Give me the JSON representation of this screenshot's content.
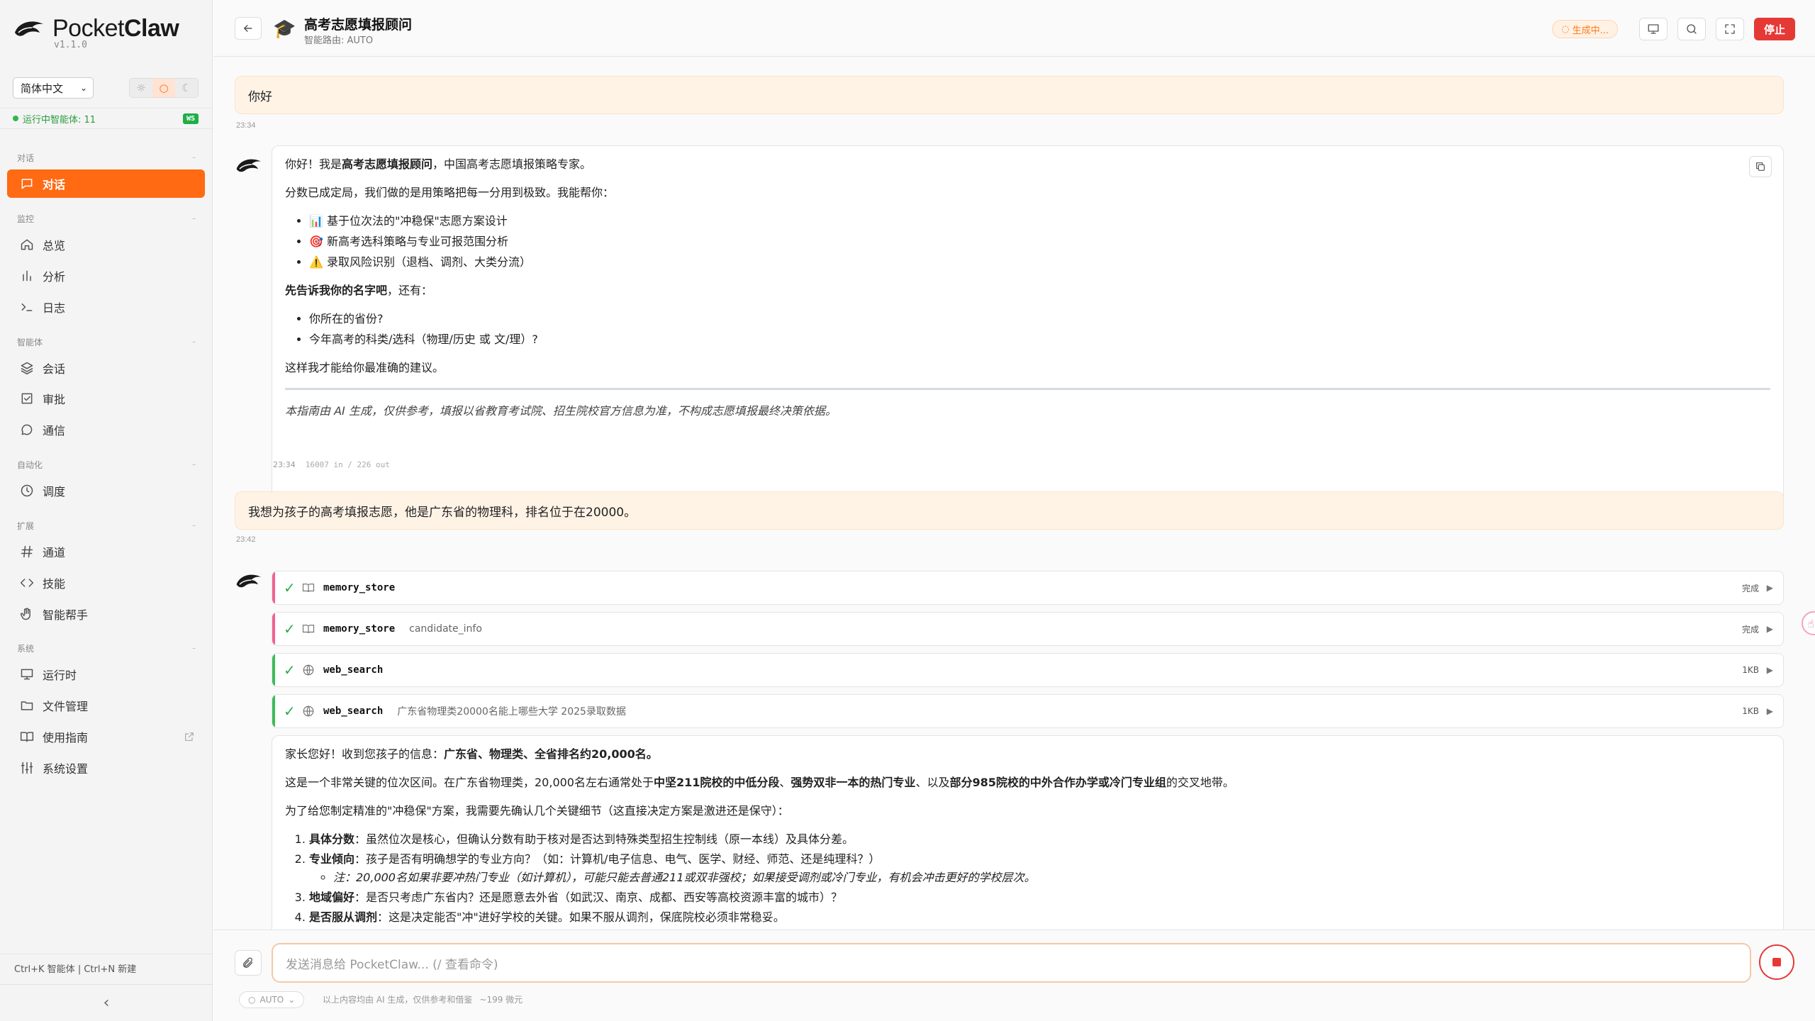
{
  "brand": {
    "name_plain": "Pocket",
    "name_bold": "Claw",
    "version": "v1.1.0"
  },
  "sidebar": {
    "language": "简体中文",
    "theme_icons": [
      "sun-icon",
      "circle-icon",
      "moon-icon"
    ],
    "status_text": "运行中智能体: 11",
    "ws_badge": "WS",
    "groups": [
      {
        "title": "对话",
        "items": [
          {
            "label": "对话",
            "icon": "chat-icon",
            "active": true
          }
        ]
      },
      {
        "title": "监控",
        "items": [
          {
            "label": "总览",
            "icon": "home-icon"
          },
          {
            "label": "分析",
            "icon": "bar-chart-icon"
          },
          {
            "label": "日志",
            "icon": "terminal-icon"
          }
        ]
      },
      {
        "title": "智能体",
        "items": [
          {
            "label": "会话",
            "icon": "layers-icon"
          },
          {
            "label": "审批",
            "icon": "checkbox-icon"
          },
          {
            "label": "通信",
            "icon": "message-icon"
          }
        ]
      },
      {
        "title": "自动化",
        "items": [
          {
            "label": "调度",
            "icon": "clock-icon"
          }
        ]
      },
      {
        "title": "扩展",
        "items": [
          {
            "label": "通道",
            "icon": "hash-icon"
          },
          {
            "label": "技能",
            "icon": "code-icon"
          },
          {
            "label": "智能帮手",
            "icon": "hand-icon"
          }
        ]
      },
      {
        "title": "系统",
        "items": [
          {
            "label": "运行时",
            "icon": "monitor-icon"
          },
          {
            "label": "文件管理",
            "icon": "folder-icon"
          },
          {
            "label": "使用指南",
            "icon": "book-icon"
          },
          {
            "label": "系统设置",
            "icon": "sliders-icon"
          }
        ]
      }
    ],
    "shortcuts": "Ctrl+K 智能体 | Ctrl+N 新建",
    "collapse_label": "‹"
  },
  "header": {
    "title": "高考志愿填报顾问",
    "subtitle": "智能路由: AUTO",
    "generating_badge": "生成中...",
    "stop_label": "停止"
  },
  "messages": {
    "user1": {
      "text": "你好",
      "time": "23:34"
    },
    "bot1": {
      "intro_prefix": "你好！我是",
      "intro_bold": "高考志愿填报顾问",
      "intro_suffix": "，中国高考志愿填报策略专家。",
      "line2": "分数已成定局，我们做的是用策略把每一分用到极致。我能帮你：",
      "capabilities": [
        {
          "emoji": "📊",
          "text": "基于位次法的\"冲稳保\"志愿方案设计"
        },
        {
          "emoji": "🎯",
          "text": "新高考选科策略与专业可报范围分析"
        },
        {
          "emoji": "⚠️",
          "text": "录取风险识别（退档、调剂、大类分流）"
        }
      ],
      "ask_bold": "先告诉我你的名字吧",
      "ask_suffix": "，还有：",
      "questions": [
        "你所在的省份?",
        "今年高考的科类/选科（物理/历史 或 文/理）?"
      ],
      "closing": "这样我才能给你最准确的建议。",
      "disclaimer": "本指南由 AI 生成，仅供参考，填报以省教育考试院、招生院校官方信息为准，不构成志愿填报最终决策依据。",
      "time": "23:34",
      "tokens": "16007 in / 226 out"
    },
    "user2": {
      "text": "我想为孩子的高考填报志愿，他是广东省的物理科，排名位于在20000。",
      "time": "23:42"
    },
    "tools": [
      {
        "name": "memory_store",
        "arg": "",
        "status": "完成",
        "icon": "book-icon",
        "color": "pink"
      },
      {
        "name": "memory_store",
        "arg": "candidate_info",
        "status": "完成",
        "icon": "book-icon",
        "color": "pink"
      },
      {
        "name": "web_search",
        "arg": "",
        "status": "1KB",
        "icon": "globe-icon",
        "color": "green"
      },
      {
        "name": "web_search",
        "arg": "广东省物理类20000名能上哪些大学 2025录取数据",
        "status": "1KB",
        "icon": "globe-icon",
        "color": "green"
      }
    ],
    "bot2": {
      "p1_prefix": "家长您好！收到您孩子的信息：",
      "p1_bold": "广东省、物理类、全省排名约20,000名。",
      "p2_a": "这是一个非常关键的位次区间。在广东省物理类，20,000名左右通常处于",
      "p2_b1": "中坚211院校的中低分段",
      "p2_c": "、",
      "p2_b2": "强势双非一本的热门专业",
      "p2_d": "、以及",
      "p2_b3": "部分985院校的中外合作办学或冷门专业组",
      "p2_e": "的交叉地带。",
      "p3": "为了给您制定精准的\"冲稳保\"方案，我需要先确认几个关键细节（这直接决定方案是激进还是保守）：",
      "items": [
        {
          "bold": "具体分数",
          "text": "：虽然位次是核心，但确认分数有助于核对是否达到特殊类型招生控制线（原一本线）及具体分差。"
        },
        {
          "bold": "专业倾向",
          "text": "：孩子是否有明确想学的专业方向？（如：计算机/电子信息、电气、医学、财经、师范、还是纯理科？）"
        },
        {
          "bold": "地域偏好",
          "text": "：是否只考虑广东省内？还是愿意去外省（如武汉、南京、成都、西安等高校资源丰富的城市）？"
        },
        {
          "bold": "是否服从调剂",
          "text": "：这是决定能否\"冲\"进好学校的关键。如果不服从调剂，保底院校必须非常稳妥。"
        }
      ],
      "sub_note": "注：20,000名如果非要冲热门专业（如计算机），可能只能去普通211或双非强校；如果接受调剂或冷门专业，有机会冲击更好的学校层次。"
    }
  },
  "composer": {
    "placeholder": "发送消息给 PocketClaw... (/ 查看命令)",
    "mode": "AUTO",
    "note": "以上内容均由 AI 生成，仅供参考和借鉴",
    "cost": "~199 微元"
  },
  "colors": {
    "accent": "#ff6a13",
    "stop": "#e53935",
    "ok": "#2faa4e"
  }
}
